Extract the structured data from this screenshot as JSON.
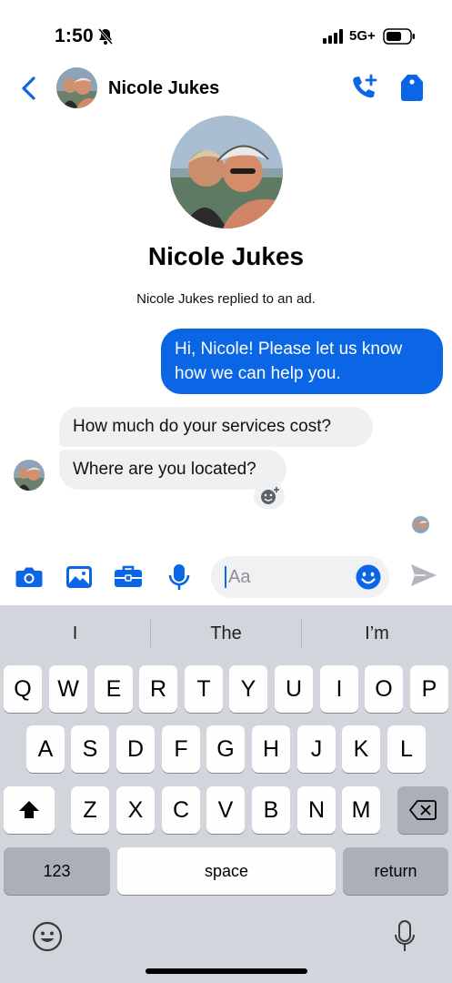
{
  "status": {
    "time": "1:50",
    "network": "5G+"
  },
  "header": {
    "contact_name": "Nicole Jukes"
  },
  "profile": {
    "name": "Nicole Jukes",
    "subtitle": "Nicole Jukes replied to an ad."
  },
  "messages": [
    {
      "direction": "outgoing",
      "text": "Hi, Nicole! Please let us know how we can help you."
    },
    {
      "direction": "incoming",
      "text": "How much do your services cost?"
    },
    {
      "direction": "incoming",
      "text": "Where are you located?"
    }
  ],
  "composer": {
    "placeholder": "Aa"
  },
  "keyboard": {
    "suggestions": [
      "I",
      "The",
      "I’m"
    ],
    "row1": [
      "Q",
      "W",
      "E",
      "R",
      "T",
      "Y",
      "U",
      "I",
      "O",
      "P"
    ],
    "row2": [
      "A",
      "S",
      "D",
      "F",
      "G",
      "H",
      "J",
      "K",
      "L"
    ],
    "row3": [
      "Z",
      "X",
      "C",
      "V",
      "B",
      "N",
      "M"
    ],
    "numbers_label": "123",
    "space_label": "space",
    "return_label": "return"
  },
  "icons": {
    "back": "chevron-left-icon",
    "call": "add-call-icon",
    "tag": "tag-icon",
    "camera": "camera-icon",
    "gallery": "image-icon",
    "briefcase": "briefcase-icon",
    "mic": "microphone-icon",
    "emoji": "smiley-icon",
    "send": "send-icon",
    "reaction": "add-reaction-icon"
  },
  "colors": {
    "accent": "#0a66e4",
    "incoming_bubble": "#eff0f2",
    "keyboard_bg": "#d2d5db"
  }
}
